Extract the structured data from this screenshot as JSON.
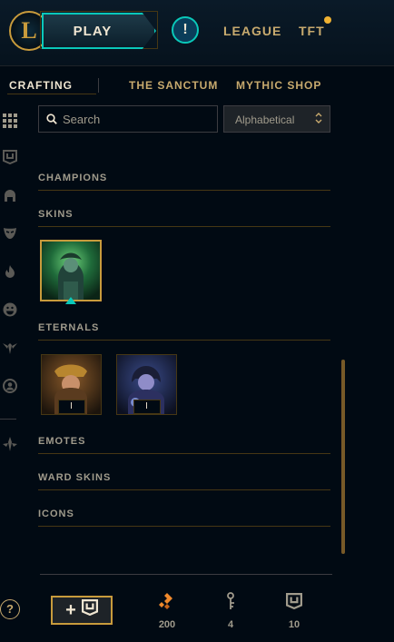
{
  "topbar": {
    "logo_letter": "L",
    "play_label": "PLAY",
    "alert_glyph": "!",
    "nav": [
      "LEAGUE",
      "TFT"
    ],
    "notification_color": "#f0b232"
  },
  "subnav": {
    "tabs": [
      "CRAFTING",
      "THE SANCTUM",
      "MYTHIC SHOP"
    ],
    "active": "CRAFTING"
  },
  "sidebar": {
    "icons": [
      "grid-icon",
      "chest-icon",
      "helmet-icon",
      "mask-icon",
      "flame-icon",
      "emote-icon",
      "ward-icon",
      "profile-icon",
      "tft-icon"
    ]
  },
  "filters": {
    "search_placeholder": "Search",
    "sort_value": "Alphabetical"
  },
  "sections": {
    "champions": "CHAMPIONS",
    "skins": "SKINS",
    "eternals": "ETERNALS",
    "emotes": "EMOTES",
    "ward_skins": "WARD SKINS",
    "icons": "ICONS"
  },
  "eternal_tiles": [
    {
      "count": "I"
    },
    {
      "count": "I"
    }
  ],
  "footer": {
    "help_glyph": "?",
    "add_glyph": "+",
    "currencies": [
      {
        "icon": "orange-essence-icon",
        "value": "200"
      },
      {
        "icon": "key-fragment-icon",
        "value": "4"
      },
      {
        "icon": "chest-icon",
        "value": "10"
      }
    ]
  },
  "colors": {
    "accent_gold": "#c89b3c",
    "accent_teal": "#0ac8b9",
    "background": "#010a13"
  }
}
